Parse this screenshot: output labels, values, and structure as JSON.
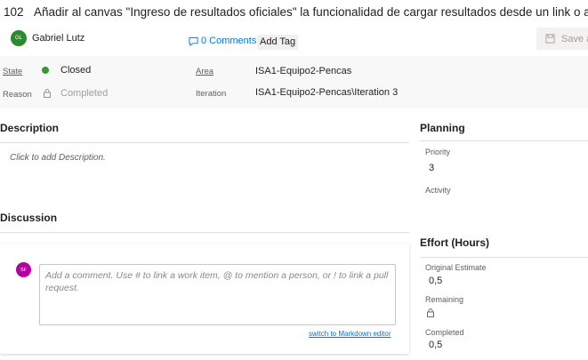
{
  "work_item": {
    "id": "102",
    "title": "Añadir al canvas \"Ingreso de resultados oficiales\" la funcionalidad de cargar resultados desde un link o archivo"
  },
  "assignee": {
    "initials": "GL",
    "name": "Gabriel Lutz"
  },
  "header": {
    "comments_label": "0 Comments",
    "add_tag_label": "Add Tag",
    "save_label": "Save a"
  },
  "fields": {
    "state_label": "State",
    "state_value": "Closed",
    "reason_label": "Reason",
    "reason_value": "Completed",
    "area_label": "Area",
    "area_value": "ISA1-Equipo2-Pencas",
    "iteration_label": "Iteration",
    "iteration_value": "ISA1-Equipo2-Pencas\\Iteration 3"
  },
  "description": {
    "title": "Description",
    "placeholder": "Click to add Description."
  },
  "discussion": {
    "title": "Discussion",
    "avatar_initials": "SF",
    "comment_placeholder": "Add a comment. Use # to link a work item, @ to mention a person, or ! to link a pull request.",
    "markdown_link": "switch to Markdown editor"
  },
  "planning": {
    "title": "Planning",
    "priority_label": "Priority",
    "priority_value": "3",
    "activity_label": "Activity",
    "activity_value": ""
  },
  "effort": {
    "title": "Effort (Hours)",
    "original_label": "Original Estimate",
    "original_value": "0,5",
    "remaining_label": "Remaining",
    "completed_label": "Completed",
    "completed_value": "0,5"
  },
  "colors": {
    "state_closed": "#339933",
    "link": "#0078d4",
    "assignee_avatar": "#2b8a2b",
    "commenter_avatar": "#b4009e"
  }
}
